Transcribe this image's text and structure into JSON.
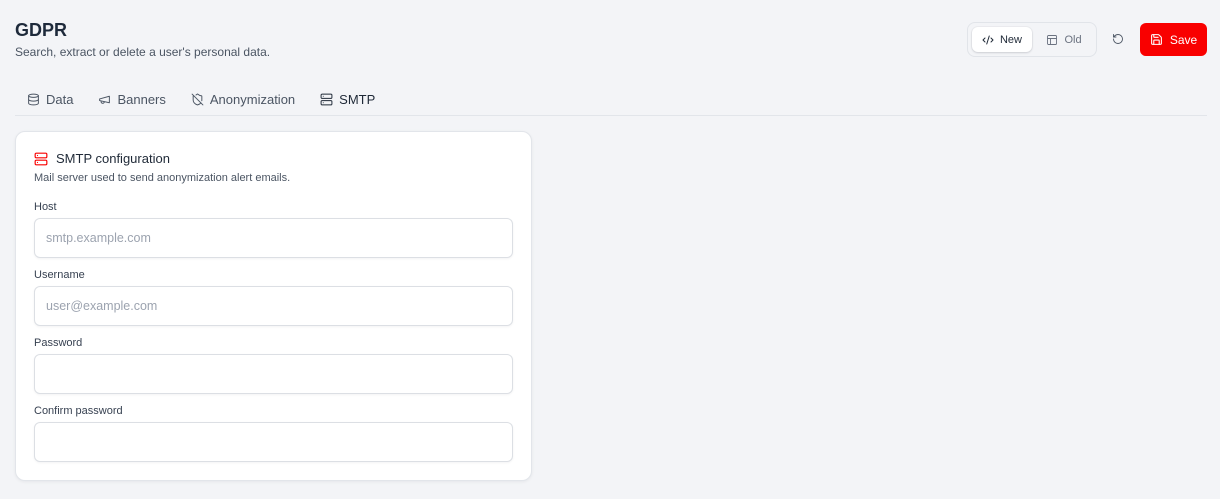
{
  "header": {
    "title": "GDPR",
    "subtitle": "Search, extract or delete a user's personal data."
  },
  "toolbar": {
    "view_toggle": {
      "options": [
        {
          "label": "New",
          "icon": "code-icon",
          "selected": true
        },
        {
          "label": "Old",
          "icon": "panels-top-left-icon",
          "selected": false
        }
      ]
    },
    "reset_icon": "rotate-ccw-icon",
    "save_label": "Save",
    "save_icon": "save-icon"
  },
  "tabs": [
    {
      "label": "Data",
      "icon": "database-icon",
      "active": false
    },
    {
      "label": "Banners",
      "icon": "megaphone-icon",
      "active": false
    },
    {
      "label": "Anonymization",
      "icon": "shield-off-icon",
      "active": false
    },
    {
      "label": "SMTP",
      "icon": "server-icon",
      "active": true
    }
  ],
  "smtp_card": {
    "icon": "server-icon",
    "title": "SMTP configuration",
    "description": "Mail server used to send anonymization alert emails.",
    "fields": [
      {
        "label": "Host",
        "placeholder": "smtp.example.com",
        "value": ""
      },
      {
        "label": "Username",
        "placeholder": "user@example.com",
        "value": ""
      },
      {
        "label": "Password",
        "placeholder": "",
        "value": ""
      },
      {
        "label": "Confirm password",
        "placeholder": "",
        "value": ""
      }
    ]
  },
  "colors": {
    "accent": "#f90000",
    "background": "#f3f4f7"
  }
}
